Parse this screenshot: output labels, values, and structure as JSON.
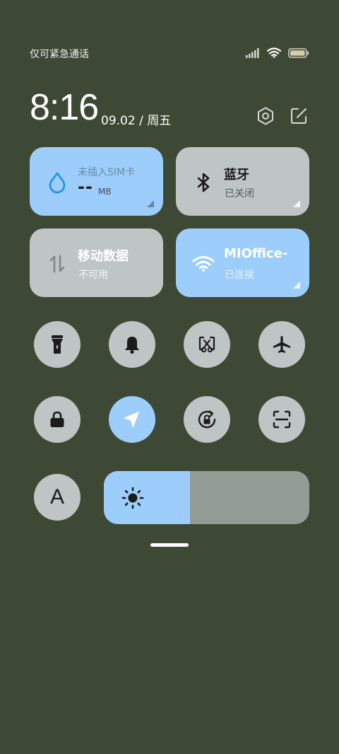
{
  "status_bar": {
    "carrier_text": "仅可紧急通话",
    "icons": [
      "signal-icon",
      "wifi-icon",
      "battery-icon"
    ]
  },
  "header": {
    "time": "8:16",
    "date": "09.02 / 周五",
    "icons": [
      "settings-icon",
      "edit-icon"
    ]
  },
  "tiles": {
    "data": {
      "title": "未插入SIM卡",
      "value": "--",
      "unit": "MB",
      "state": "on"
    },
    "bluetooth": {
      "title": "蓝牙",
      "subtitle": "已关闭",
      "state": "off"
    },
    "mobile_data": {
      "title": "移动数据",
      "subtitle": "不可用",
      "state": "off"
    },
    "wifi": {
      "title": "MIOffice-",
      "subtitle": "已连接",
      "state": "on"
    }
  },
  "toggles": [
    {
      "icon": "flashlight-icon",
      "state": "off"
    },
    {
      "icon": "bell-icon",
      "state": "off"
    },
    {
      "icon": "screenshot-icon",
      "state": "off"
    },
    {
      "icon": "airplane-icon",
      "state": "off"
    },
    {
      "icon": "lock-icon",
      "state": "off"
    },
    {
      "icon": "location-icon",
      "state": "on"
    },
    {
      "icon": "rotation-lock-icon",
      "state": "off"
    },
    {
      "icon": "scanner-icon",
      "state": "off"
    }
  ],
  "auto_brightness": {
    "label": "A",
    "icon": "auto-brightness-icon"
  },
  "brightness": {
    "level": 0.42,
    "icon": "sun-icon"
  },
  "colors": {
    "background": "#3d4935",
    "active": "#9dcdfb",
    "inactive": "#bfc5c4",
    "track": "#939d95"
  }
}
